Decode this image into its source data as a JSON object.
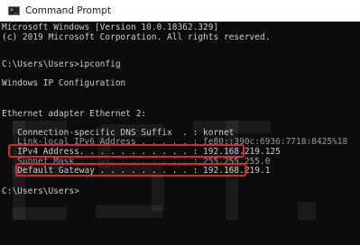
{
  "window": {
    "title": "Command Prompt",
    "title_icon": "cmd-icon"
  },
  "console": {
    "version_line": "Microsoft Windows [Version 10.0.18362.329]",
    "copyright_line": "(c) 2019 Microsoft Corporation. All rights reserved.",
    "prompt_1": "C:\\Users\\Users>ipconfig",
    "config_header": "Windows IP Configuration",
    "adapter_header": "Ethernet adapter Ethernet 2:",
    "dns_suffix_line": "   Connection-specific DNS Suffix  . : kornet",
    "link_local_line": "   Link-local IPv6 Address . . . . . : fe80::390c:6936:7718:8425%18",
    "ipv4_line": "   IPv4 Address. . . . . . . . . . . : 192.168.219.125",
    "subnet_line": "   Subnet Mask . . . . . . . . . . . : 255.255.255.0",
    "gateway_line": "   Default Gateway . . . . . . . . . : 192.168.219.1",
    "prompt_2": "C:\\Users\\Users>"
  },
  "colors": {
    "background": "#0c0c0c",
    "text": "#cccccc",
    "highlight": "#e0242b"
  }
}
